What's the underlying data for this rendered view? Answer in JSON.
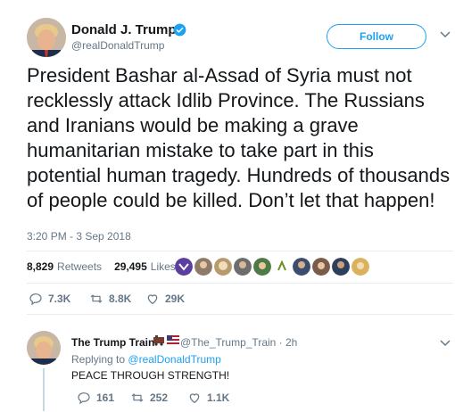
{
  "author": {
    "name": "Donald J. Trump",
    "handle": "@realDonaldTrump",
    "verified_icon": "verified-badge-icon"
  },
  "follow_label": "Follow",
  "tweet": {
    "text": "President Bashar al-Assad of Syria must not recklessly attack Idlib Province. The Russians and Iranians would be making a grave humanitarian mistake to take part in this potential human tragedy. Hundreds of thousands of people could be killed. Don’t let that happen!",
    "timestamp": "3:20 PM - 3 Sep 2018"
  },
  "stats": {
    "retweets_count": "8,829",
    "retweets_label": "Retweets",
    "likes_count": "29,495",
    "likes_label": "Likes"
  },
  "actions": {
    "reply_count": "7.3K",
    "retweet_count": "8.8K",
    "like_count": "29K"
  },
  "reply": {
    "name": "The Trump Train",
    "handle_time": "@The_Trump_Train · 2h",
    "replying_prefix": "Replying to",
    "replying_to": "@realDonaldTrump",
    "text": "PEACE THROUGH STRENGTH!",
    "reply_count": "161",
    "retweet_count": "252",
    "like_count": "1.1K"
  },
  "colors": {
    "accent": "#1da1f2",
    "secondary_text": "#657786",
    "divider": "#e6ecf0"
  }
}
